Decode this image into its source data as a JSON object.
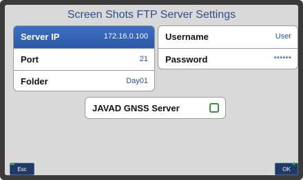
{
  "title": "Screen Shots FTP Server Settings",
  "left_panel": {
    "rows": [
      {
        "label": "Server IP",
        "value": "172.16.0.100",
        "selected": true
      },
      {
        "label": "Port",
        "value": "21",
        "selected": false
      },
      {
        "label": "Folder",
        "value": "Day01",
        "selected": false
      }
    ]
  },
  "right_panel": {
    "rows": [
      {
        "label": "Username",
        "value": "User"
      },
      {
        "label": "Password",
        "value": "******"
      }
    ]
  },
  "javad_option": {
    "label": "JAVAD GNSS Server",
    "checked": false
  },
  "softkeys": {
    "left": "Esc",
    "right": "OK"
  },
  "colors": {
    "accent": "#2d59a6",
    "title": "#2a4f8c",
    "check": "#3d8f3d"
  }
}
